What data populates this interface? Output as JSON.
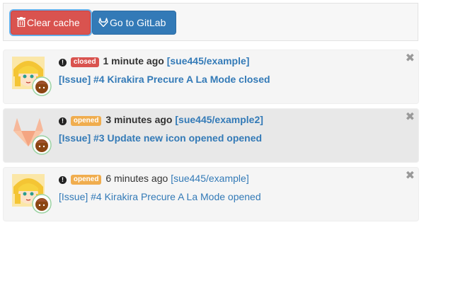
{
  "toolbar": {
    "clear_label": "Clear cache",
    "gitlab_label": "Go to GitLab",
    "clear_color": "#d9534f",
    "gitlab_color": "#337ab7"
  },
  "notifications": [
    {
      "status": "closed",
      "time": "1 minute ago",
      "repo": "[sue445/example]",
      "title": "[Issue] #4 Kirakira Precure A La Mode closed",
      "avatar": "precure-avatar",
      "bold": true,
      "status_color": "#d9534f"
    },
    {
      "status": "opened",
      "time": "3 minutes ago",
      "repo": "[sue445/example2]",
      "title": "[Issue] #3 Update new icon opened opened",
      "avatar": "gitlab-avatar",
      "bold": true,
      "status_color": "#f0ad4e"
    },
    {
      "status": "opened",
      "time": "6 minutes ago",
      "repo": "[sue445/example]",
      "title": "[Issue] #4 Kirakira Precure A La Mode opened",
      "avatar": "precure-avatar",
      "bold": false,
      "status_color": "#f0ad4e"
    }
  ]
}
